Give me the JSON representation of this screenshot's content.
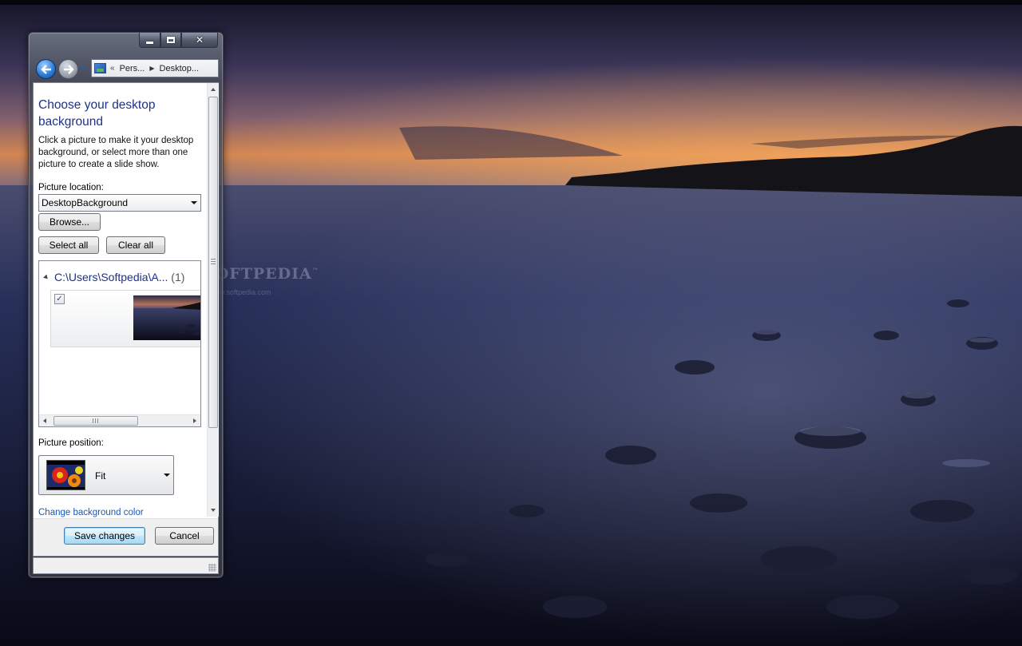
{
  "window": {
    "caption_buttons": {
      "minimize": "minimize-icon",
      "maximize": "maximize-icon",
      "close": "close-icon"
    },
    "address_bar": {
      "chevron": "«",
      "crumbs": [
        "Pers...",
        "Desktop..."
      ]
    }
  },
  "page": {
    "heading": "Choose your desktop background",
    "description": "Click a picture to make it your desktop background, or select more than one picture to create a slide show.",
    "picture_location_label": "Picture location:",
    "picture_location_value": "DesktopBackground",
    "browse_label": "Browse...",
    "select_all_label": "Select all",
    "clear_all_label": "Clear all",
    "group": {
      "path": "C:\\Users\\Softpedia\\A...",
      "count": "(1)",
      "checked": true,
      "check_glyph": "✓"
    },
    "hscroll_grip": "III",
    "picture_position_label": "Picture position:",
    "picture_position_value": "Fit",
    "change_color_link": "Change background color"
  },
  "footer": {
    "save_label": "Save changes",
    "cancel_label": "Cancel"
  },
  "desktop": {
    "watermark": "SOFTPEDIA",
    "watermark_tm": "™",
    "watermark_sub": "www.softpedia.com"
  },
  "colors": {
    "accent_heading": "#1e3287",
    "link": "#1a57b8",
    "sky_glow": "#e08a4a"
  }
}
